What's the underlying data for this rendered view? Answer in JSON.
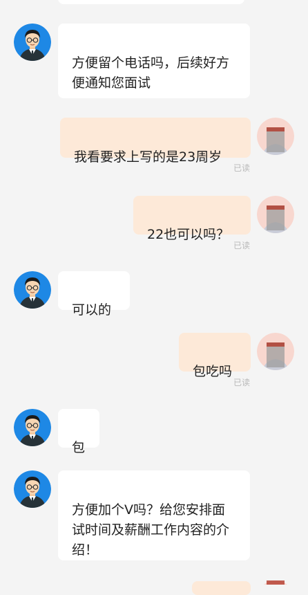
{
  "messages": [
    {
      "side": "in",
      "text": "方便留个电话吗，后续好方便通知您面试"
    },
    {
      "side": "out",
      "text": "我看要求上写的是23周岁",
      "status": "已读"
    },
    {
      "side": "out",
      "text": "22也可以吗？",
      "status": "已读"
    },
    {
      "side": "in",
      "text": "可以的"
    },
    {
      "side": "out",
      "text": "包吃吗",
      "status": "已读"
    },
    {
      "side": "in",
      "text": "包"
    },
    {
      "side": "in",
      "text": "方便加个V吗？给您安排面试时间及薪酬工作内容的介绍！"
    }
  ],
  "icons": {
    "agent_avatar": "recruiter-avatar-icon",
    "user_avatar": "user-avatar-icon"
  },
  "colors": {
    "background": "#f4f4f4",
    "incoming_bubble": "#ffffff",
    "outgoing_bubble": "#fde9d8",
    "agent_avatar_bg": "#1e88e5",
    "user_avatar_bg": "#f8d7cf",
    "read_status": "#b9b9b9"
  }
}
